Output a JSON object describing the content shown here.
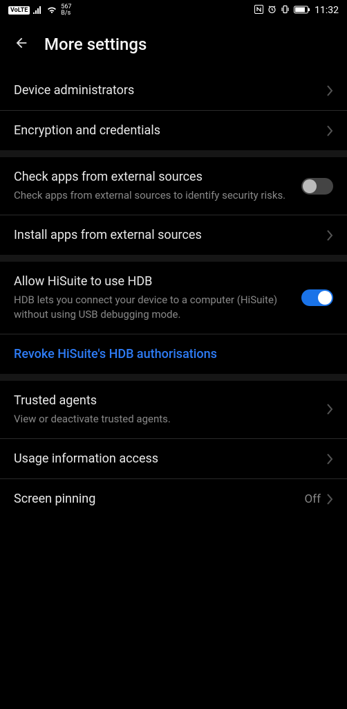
{
  "statusbar": {
    "volte": "VoLTE",
    "net_speed_num": "567",
    "net_speed_unit": "B/s",
    "time": "11:32"
  },
  "header": {
    "title": "More settings"
  },
  "sections": {
    "group1": {
      "device_admin": "Device administrators",
      "encryption": "Encryption and credentials"
    },
    "group2": {
      "check_apps_title": "Check apps from external sources",
      "check_apps_sub": "Check apps from external sources to identify security risks.",
      "install_apps": "Install apps from external sources"
    },
    "group3": {
      "hdb_title": "Allow HiSuite to use HDB",
      "hdb_sub": "HDB lets you connect your device to a computer (HiSuite) without using USB debugging mode.",
      "revoke": "Revoke HiSuite's HDB authorisations"
    },
    "group4": {
      "trusted_title": "Trusted agents",
      "trusted_sub": "View or deactivate trusted agents.",
      "usage": "Usage information access",
      "pinning_title": "Screen pinning",
      "pinning_value": "Off"
    }
  }
}
